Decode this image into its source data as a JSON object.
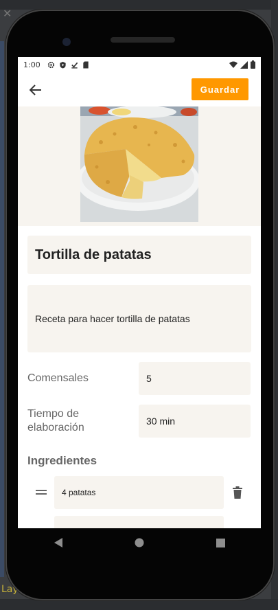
{
  "status_bar": {
    "time": "1:00",
    "left_icons": [
      "gear-icon",
      "shield-icon",
      "download-done-icon",
      "sd-card-icon"
    ],
    "right_icons": [
      "wifi-icon",
      "signal-icon",
      "battery-icon"
    ]
  },
  "app_bar": {
    "back_icon": "arrow-back-icon",
    "save_label": "Guardar",
    "accent_color": "#ff9800"
  },
  "recipe": {
    "title": "Tortilla de patatas",
    "description": "Receta para hacer tortilla de patatas",
    "servings_label": "Comensales",
    "servings_value": "5",
    "time_label": "Tiempo de elaboración",
    "time_value": "30 min",
    "ingredients_heading": "Ingredientes",
    "ingredients": [
      {
        "text": "4 patatas"
      },
      {
        "text": ""
      }
    ]
  },
  "android_nav": {
    "icons": [
      "back-triangle-icon",
      "home-circle-icon",
      "recents-square-icon"
    ]
  },
  "ide": {
    "bottom_text": "Lay"
  }
}
